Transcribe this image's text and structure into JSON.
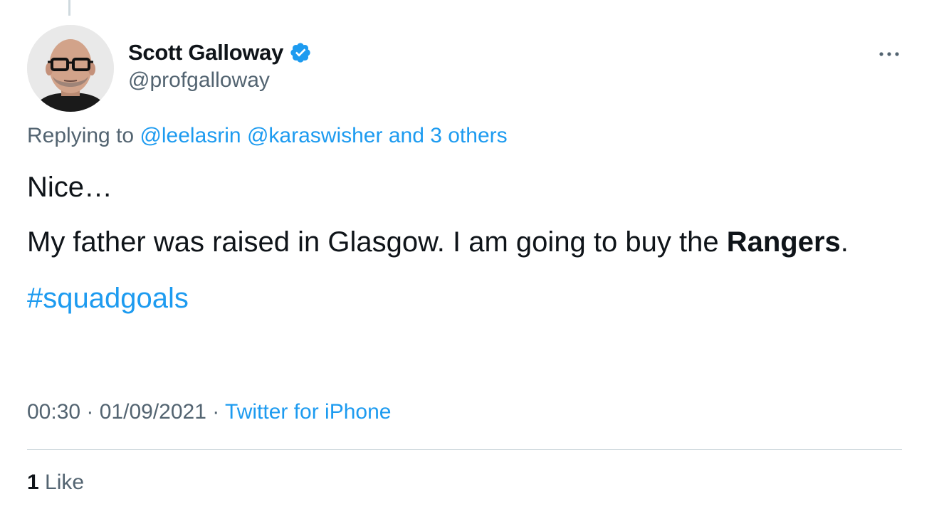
{
  "author": {
    "display_name": "Scott Galloway",
    "handle": "@profgalloway",
    "verified": true
  },
  "reply": {
    "prefix": "Replying to",
    "mentions": [
      "@leelasrin",
      "@karaswisher"
    ],
    "others": "and 3 others"
  },
  "tweet": {
    "para1": "Nice…",
    "para2_text": "My father was raised in Glasgow.  I am going to buy the",
    "para2_bold": "Rangers",
    "para2_end": ".",
    "hashtag": "#squadgoals"
  },
  "meta": {
    "time": "00:30",
    "sep1": " · ",
    "date": "01/09/2021",
    "sep2": " · ",
    "source": "Twitter for iPhone"
  },
  "stats": {
    "likes_count": "1",
    "likes_label": "Like"
  },
  "colors": {
    "accent": "#1d9bf0",
    "secondary_text": "#536471",
    "primary_text": "#0f1419",
    "divider": "#cfd9de"
  },
  "icons": {
    "verified": "verified-badge-icon",
    "more": "more-options-icon"
  }
}
